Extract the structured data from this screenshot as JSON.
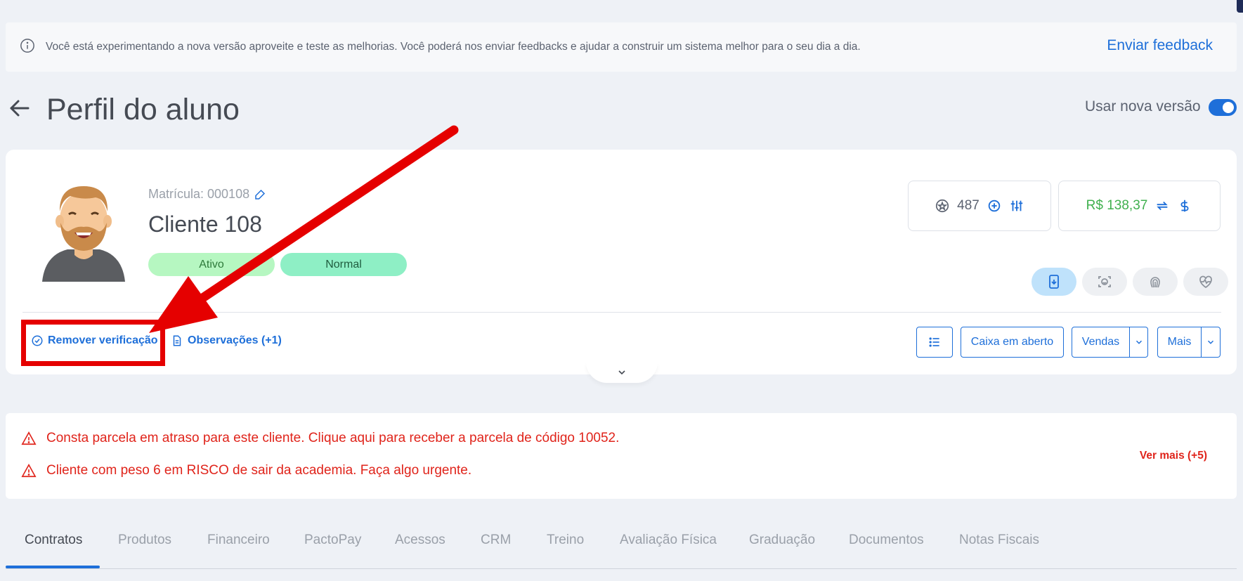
{
  "banner": {
    "message": "Você está experimentando a nova versão aproveite e teste as melhorias. Você poderá nos enviar feedbacks e ajudar a construir um sistema melhor para o seu dia a dia.",
    "feedback_link": "Enviar feedback"
  },
  "header": {
    "title": "Perfil do aluno",
    "toggle_label": "Usar nova versão",
    "toggle_on": true
  },
  "profile": {
    "matricula": "Matrícula: 000108",
    "name": "Cliente 108",
    "badges": [
      "Ativo",
      "Normal"
    ],
    "points": "487",
    "balance": "R$ 138,37"
  },
  "actions": {
    "remove_verification": "Remover verificação",
    "observations": "Observações (+1)",
    "caixa_em_aberto": "Caixa em aberto",
    "vendas": "Vendas",
    "mais": "Mais"
  },
  "alerts": {
    "items": [
      "Consta parcela em atraso para este cliente. Clique aqui para receber a parcela de código 10052.",
      "Cliente com peso 6 em RISCO de sair da academia. Faça algo urgente."
    ],
    "ver_mais": "Ver mais (+5)"
  },
  "tabs": [
    "Contratos",
    "Produtos",
    "Financeiro",
    "PactoPay",
    "Acessos",
    "CRM",
    "Treino",
    "Avaliação Física",
    "Graduação",
    "Documentos",
    "Notas Fiscais"
  ],
  "active_tab": "Contratos",
  "colors": {
    "accent": "#1e6fd9",
    "alert": "#e0241b",
    "balance": "#3fb04e",
    "annotation": "#e50000"
  }
}
